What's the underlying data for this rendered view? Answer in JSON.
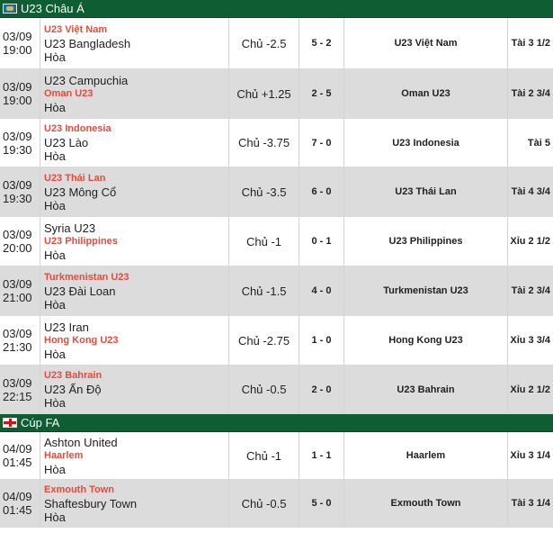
{
  "groups": [
    {
      "league": "U23 Châu Á",
      "flag": "asia-flag-icon",
      "matches": [
        {
          "date": "03/09",
          "time": "19:00",
          "teams": [
            {
              "name": "U23 Việt Nam",
              "fav": true
            },
            {
              "name": "U23 Bangladesh",
              "fav": false
            },
            {
              "name": "Hòa",
              "fav": false
            }
          ],
          "odds": "Chủ -2.5",
          "score": "5 - 2",
          "pick": "U23 Việt Nam",
          "ou": "Tài 3 1/2"
        },
        {
          "date": "03/09",
          "time": "19:00",
          "teams": [
            {
              "name": "U23 Campuchia",
              "fav": false
            },
            {
              "name": "Oman U23",
              "fav": true
            },
            {
              "name": "Hòa",
              "fav": false
            }
          ],
          "odds": "Chủ +1.25",
          "score": "2 - 5",
          "pick": "Oman U23",
          "ou": "Tài 2 3/4"
        },
        {
          "date": "03/09",
          "time": "19:30",
          "teams": [
            {
              "name": "U23 Indonesia",
              "fav": true
            },
            {
              "name": "U23 Lào",
              "fav": false
            },
            {
              "name": "Hòa",
              "fav": false
            }
          ],
          "odds": "Chủ -3.75",
          "score": "7 - 0",
          "pick": "U23 Indonesia",
          "ou": "Tài 5"
        },
        {
          "date": "03/09",
          "time": "19:30",
          "teams": [
            {
              "name": "U23 Thái Lan",
              "fav": true
            },
            {
              "name": "U23 Mông Cổ",
              "fav": false
            },
            {
              "name": "Hòa",
              "fav": false
            }
          ],
          "odds": "Chủ -3.5",
          "score": "6 - 0",
          "pick": "U23 Thái Lan",
          "ou": "Tài 4 3/4"
        },
        {
          "date": "03/09",
          "time": "20:00",
          "teams": [
            {
              "name": "Syria U23",
              "fav": false
            },
            {
              "name": "U23 Philippines",
              "fav": true
            },
            {
              "name": "Hòa",
              "fav": false
            }
          ],
          "odds": "Chủ -1",
          "score": "0 - 1",
          "pick": "U23 Philippines",
          "ou": "Xỉu 2 1/2"
        },
        {
          "date": "03/09",
          "time": "21:00",
          "teams": [
            {
              "name": "Turkmenistan U23",
              "fav": true
            },
            {
              "name": "U23 Đài Loan",
              "fav": false
            },
            {
              "name": "Hòa",
              "fav": false
            }
          ],
          "odds": "Chủ -1.5",
          "score": "4 - 0",
          "pick": "Turkmenistan U23",
          "ou": "Tài 2 3/4"
        },
        {
          "date": "03/09",
          "time": "21:30",
          "teams": [
            {
              "name": "U23 Iran",
              "fav": false
            },
            {
              "name": "Hong Kong U23",
              "fav": true
            },
            {
              "name": "Hòa",
              "fav": false
            }
          ],
          "odds": "Chủ -2.75",
          "score": "1 - 0",
          "pick": "Hong Kong U23",
          "ou": "Xỉu 3 3/4"
        },
        {
          "date": "03/09",
          "time": "22:15",
          "teams": [
            {
              "name": "U23 Bahrain",
              "fav": true
            },
            {
              "name": "U23 Ấn Độ",
              "fav": false
            },
            {
              "name": "Hòa",
              "fav": false
            }
          ],
          "odds": "Chủ -0.5",
          "score": "2 - 0",
          "pick": "U23 Bahrain",
          "ou": "Xỉu 2 1/2"
        }
      ]
    },
    {
      "league": "Cúp FA",
      "flag": "england-flag-icon",
      "matches": [
        {
          "date": "04/09",
          "time": "01:45",
          "teams": [
            {
              "name": "Ashton United",
              "fav": false
            },
            {
              "name": "Haarlem",
              "fav": true
            },
            {
              "name": "Hòa",
              "fav": false
            }
          ],
          "odds": "Chủ -1",
          "score": "1 - 1",
          "pick": "Haarlem",
          "ou": "Xỉu 3 1/4"
        },
        {
          "date": "04/09",
          "time": "01:45",
          "teams": [
            {
              "name": "Exmouth Town",
              "fav": true
            },
            {
              "name": "Shaftesbury Town",
              "fav": false
            },
            {
              "name": "Hòa",
              "fav": false
            }
          ],
          "odds": "Chủ -0.5",
          "score": "5 - 0",
          "pick": "Exmouth Town",
          "ou": "Tài 3 1/4"
        }
      ]
    }
  ]
}
